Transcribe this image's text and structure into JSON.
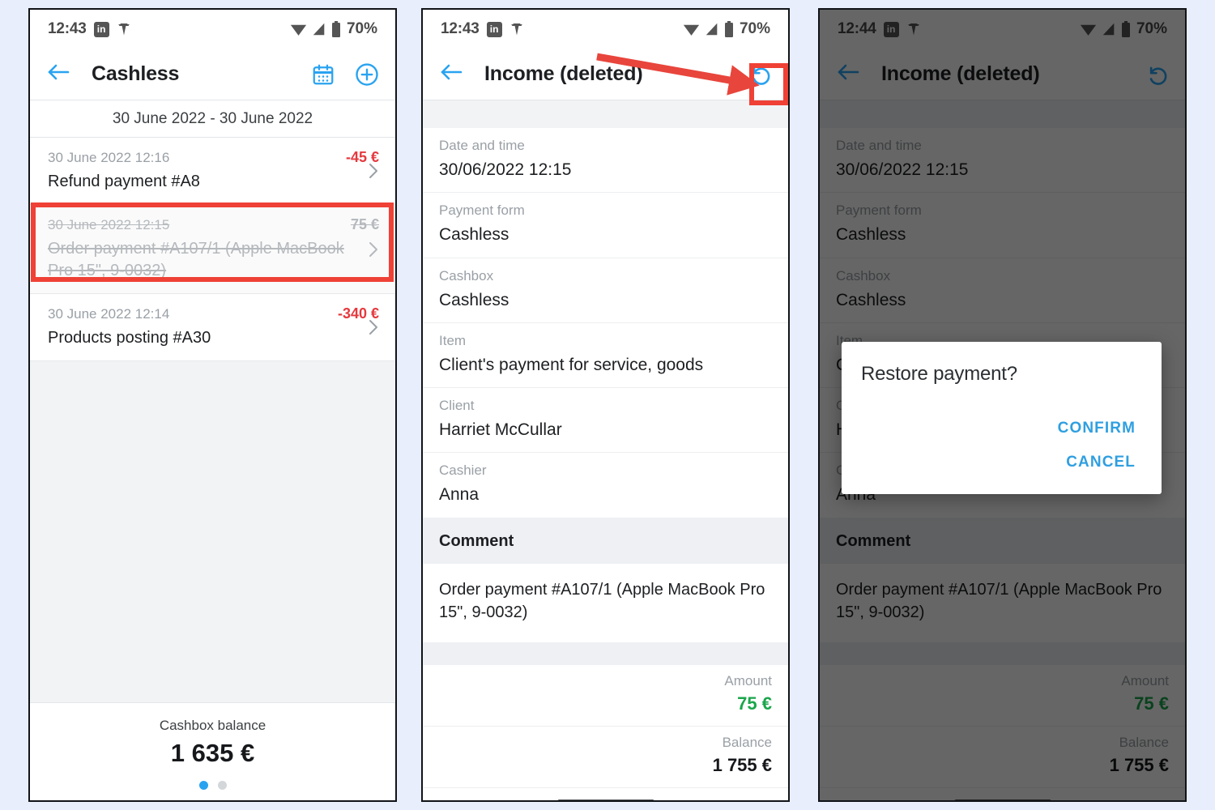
{
  "statusbar": {
    "time_1": "12:43",
    "time_2": "12:43",
    "time_3": "12:44",
    "linkedin_glyph": "in",
    "battery_pct": "70%"
  },
  "panel1": {
    "title": "Cashless",
    "date_range": "30 June 2022 - 30 June 2022",
    "transactions": [
      {
        "date": "30 June 2022 12:16",
        "amount": "-45 €",
        "title": "Refund payment #A8",
        "state": "normal",
        "amount_class": "neg"
      },
      {
        "date": "30 June 2022 12:15",
        "amount": "75 €",
        "title": "Order payment #A107/1 (Apple MacBook Pro 15\", 9-0032)",
        "state": "deleted",
        "amount_class": "muted"
      },
      {
        "date": "30 June 2022 12:14",
        "amount": "-340 €",
        "title": "Products posting #A30",
        "state": "normal",
        "amount_class": "neg"
      }
    ],
    "footer": {
      "balance_label": "Cashbox balance",
      "balance_value": "1 635 €"
    },
    "icons": {
      "back": "back-arrow-icon",
      "calendar": "calendar-icon",
      "add": "add-circle-icon"
    }
  },
  "panel2": {
    "title": "Income (deleted)",
    "fields": [
      {
        "label": "Date and time",
        "value": "30/06/2022 12:15"
      },
      {
        "label": "Payment form",
        "value": "Cashless"
      },
      {
        "label": "Cashbox",
        "value": "Cashless"
      },
      {
        "label": "Item",
        "value": "Client's payment for service, goods"
      },
      {
        "label": "Client",
        "value": "Harriet McCullar"
      },
      {
        "label": "Cashier",
        "value": "Anna"
      }
    ],
    "comment_header": "Comment",
    "comment_text": "Order payment #A107/1 (Apple MacBook Pro 15\", 9-0032)",
    "amount_label": "Amount",
    "amount_value": "75 €",
    "balance_label": "Balance",
    "balance_value": "1 755 €",
    "icons": {
      "back": "back-arrow-icon",
      "restore": "restore-icon"
    }
  },
  "panel3": {
    "title": "Income (deleted)",
    "dialog": {
      "title": "Restore payment?",
      "confirm_label": "CONFIRM",
      "cancel_label": "CANCEL"
    }
  },
  "colors": {
    "accent_blue": "#29a3f0",
    "negative_red": "#e5393e",
    "positive_green": "#1aa64b",
    "annotation_red": "#ef4136",
    "page_background": "#e8eefb",
    "muted_text": "#9aa0a6"
  }
}
